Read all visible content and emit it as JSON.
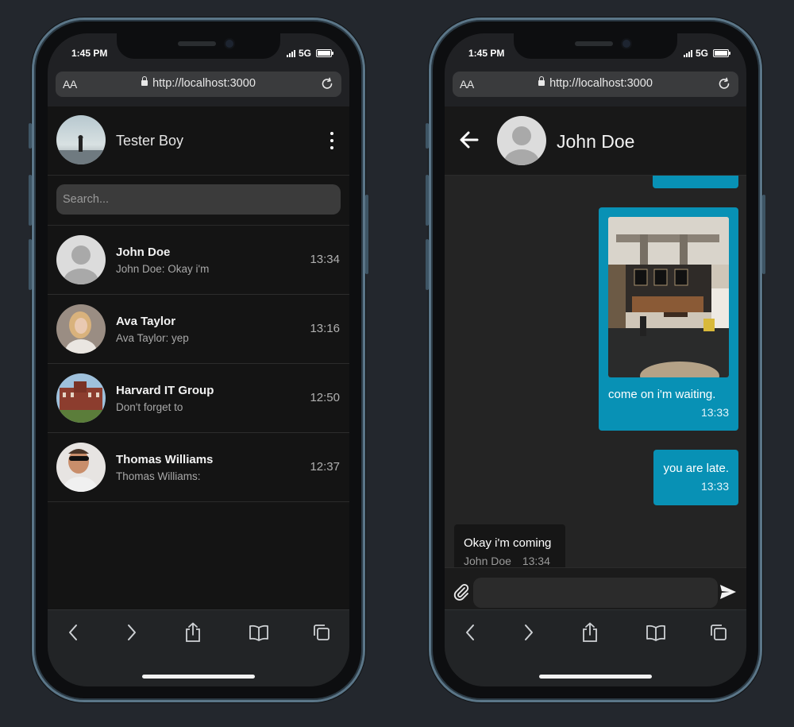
{
  "left_phone": {
    "status": {
      "time": "1:45 PM",
      "network": "5G"
    },
    "browser": {
      "aa_small": "A",
      "aa_big": "A",
      "url": "http://localhost:3000"
    },
    "profile": {
      "name": "Tester Boy"
    },
    "search": {
      "placeholder": "Search..."
    },
    "chats": [
      {
        "name": "John Doe",
        "preview": "John Doe: Okay i'm",
        "time": "13:34"
      },
      {
        "name": "Ava Taylor",
        "preview": "Ava Taylor: yep",
        "time": "13:16"
      },
      {
        "name": "Harvard IT Group",
        "preview": "Don't forget to",
        "time": "12:50"
      },
      {
        "name": "Thomas Williams",
        "preview": "Thomas Williams:",
        "time": "12:37"
      }
    ]
  },
  "right_phone": {
    "status": {
      "time": "1:45 PM",
      "network": "5G"
    },
    "browser": {
      "aa_small": "A",
      "aa_big": "A",
      "url": "http://localhost:3000"
    },
    "contact": {
      "name": "John Doe"
    },
    "messages": [
      {
        "text": "come on i'm waiting.",
        "time": "13:33"
      },
      {
        "text": "you are late.",
        "time": "13:33"
      },
      {
        "text": "Okay i'm coming",
        "sender": "John Doe",
        "time": "13:34"
      }
    ],
    "composer": {
      "value": ""
    }
  },
  "colors": {
    "accent": "#0891b5",
    "background": "#141414",
    "frame": "#5b7688"
  },
  "icons": [
    "lock-icon",
    "reload-icon",
    "kebab-menu-icon",
    "back-arrow-icon",
    "paperclip-icon",
    "send-icon",
    "chevron-left-icon",
    "chevron-right-icon",
    "share-icon",
    "book-icon",
    "tabs-icon"
  ]
}
